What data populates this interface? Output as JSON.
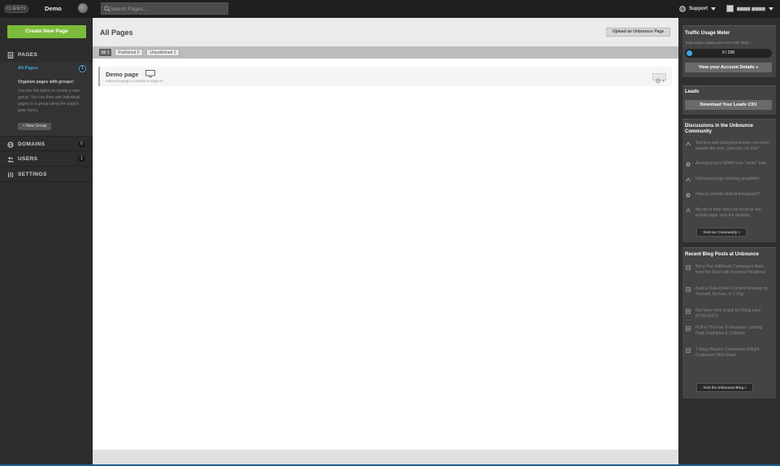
{
  "topbar": {
    "clients_label": "CLIENTS",
    "app_name": "Demo",
    "search_placeholder": "Search Pages...",
    "support_label": "Support"
  },
  "sidebar": {
    "create_button": "Create New Page",
    "sections": [
      {
        "label": "PAGES",
        "icon": "pages-icon"
      },
      {
        "label": "DOMAINS",
        "icon": "globe-icon",
        "count": "0"
      },
      {
        "label": "USERS",
        "icon": "users-icon",
        "count": "1"
      },
      {
        "label": "SETTINGS",
        "icon": "settings-icon"
      }
    ],
    "all_pages_label": "All Pages",
    "all_pages_count": "1",
    "help_title": "Organize pages with groups!",
    "help_body": "Use the link below to create a new group. You can then add individual pages to a group using the page's gear menu.",
    "new_group_button": "+ New Group"
  },
  "main": {
    "title": "All Pages",
    "upload_button": "Upload an Unbounce Page",
    "filters": [
      {
        "label": "All 1",
        "active": true
      },
      {
        "label": "Published 0",
        "active": false
      },
      {
        "label": "Unpublished 1",
        "active": false
      }
    ],
    "page": {
      "name": "Demo page",
      "url": "unbouncepages.com/demo-page-6/"
    }
  },
  "rightbar": {
    "traffic_title": "Traffic Usage Meter",
    "traffic_sub": "Total unique visitors since Oct 10th, 2015",
    "traffic_value": "0 / 200",
    "traffic_fraction": 0,
    "account_button": "View your Account Details »",
    "leads_title": "Leads",
    "leads_button": "Download Your Leads CSV",
    "community_title": "Discussions in the Unbounce Community",
    "discussions": [
      {
        "text": "Text box with background does not reach outside the form, how can I fix this?",
        "icon": "up-chevron-icon"
      },
      {
        "text": "Annoying form SPAM from \"smart\" bots",
        "icon": "chat-icon"
      },
      {
        "text": "Unbounce page blocking googlebot",
        "icon": "up-chevron-icon"
      },
      {
        "text": "How to override default breakpoint?",
        "icon": "chat-icon"
      },
      {
        "text": "My opt in form does not show on the mobile page, only the desktop",
        "icon": "up-chevron-icon"
      }
    ],
    "community_button": "Visit our Community »",
    "blog_title": "Recent Blog Posts at Unbounce",
    "blog_posts": [
      "Bring Your AdWords Campaigns Back from the Dead with Keyword Headlines",
      "Build a Data-Driven Content Strategy by Yourself, for Free, in 1 Day",
      "Get More from Social by Doing Less [PODCAST]",
      "Fluff is Thy Foe: 6 Insurance Landing Page Examples & Critiques",
      "7 Ways Bigshot Companies Delight Customers With Email"
    ],
    "blog_button": "Visit the Unbounce Blog »"
  },
  "colors": {
    "accent_green": "#7cbc3a",
    "accent_blue": "#3fa8e0"
  }
}
